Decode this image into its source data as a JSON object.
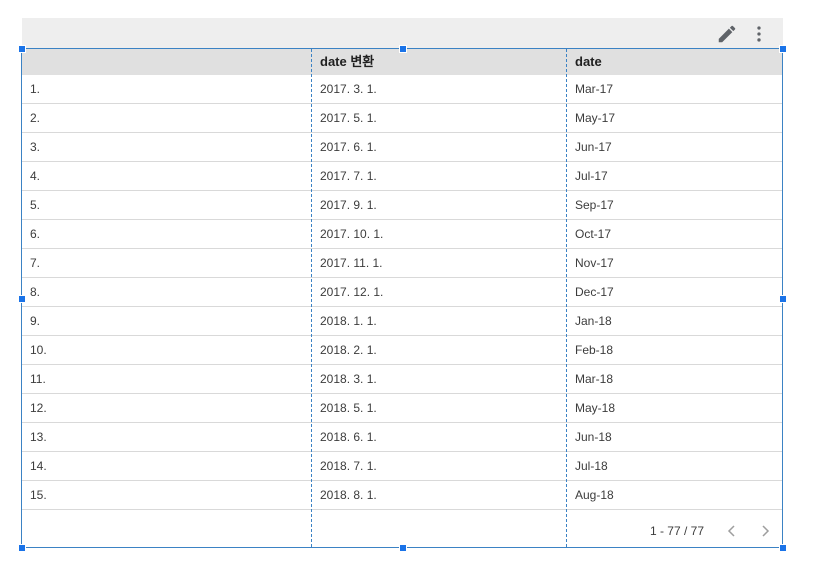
{
  "toolbar": {
    "edit_icon": "pencil-icon",
    "more_icon": "more-vert-icon"
  },
  "table": {
    "columns": [
      "",
      "date 변환",
      "date"
    ],
    "rows": [
      {
        "index": "1.",
        "converted": "2017. 3. 1.",
        "date": "Mar-17"
      },
      {
        "index": "2.",
        "converted": "2017. 5. 1.",
        "date": "May-17"
      },
      {
        "index": "3.",
        "converted": "2017. 6. 1.",
        "date": "Jun-17"
      },
      {
        "index": "4.",
        "converted": "2017. 7. 1.",
        "date": "Jul-17"
      },
      {
        "index": "5.",
        "converted": "2017. 9. 1.",
        "date": "Sep-17"
      },
      {
        "index": "6.",
        "converted": "2017. 10. 1.",
        "date": "Oct-17"
      },
      {
        "index": "7.",
        "converted": "2017. 11. 1.",
        "date": "Nov-17"
      },
      {
        "index": "8.",
        "converted": "2017. 12. 1.",
        "date": "Dec-17"
      },
      {
        "index": "9.",
        "converted": "2018. 1. 1.",
        "date": "Jan-18"
      },
      {
        "index": "10.",
        "converted": "2018. 2. 1.",
        "date": "Feb-18"
      },
      {
        "index": "11.",
        "converted": "2018. 3. 1.",
        "date": "Mar-18"
      },
      {
        "index": "12.",
        "converted": "2018. 5. 1.",
        "date": "May-18"
      },
      {
        "index": "13.",
        "converted": "2018. 6. 1.",
        "date": "Jun-18"
      },
      {
        "index": "14.",
        "converted": "2018. 7. 1.",
        "date": "Jul-18"
      },
      {
        "index": "15.",
        "converted": "2018. 8. 1.",
        "date": "Aug-18"
      }
    ]
  },
  "pagination": {
    "text": "1 - 77 / 77",
    "prev_icon": "chevron-left-icon",
    "next_icon": "chevron-right-icon"
  },
  "colors": {
    "selection": "#3b82c4",
    "handle": "#1a73e8",
    "header_bg": "#e0e0e0",
    "toolbar_bg": "#eeeeee"
  }
}
